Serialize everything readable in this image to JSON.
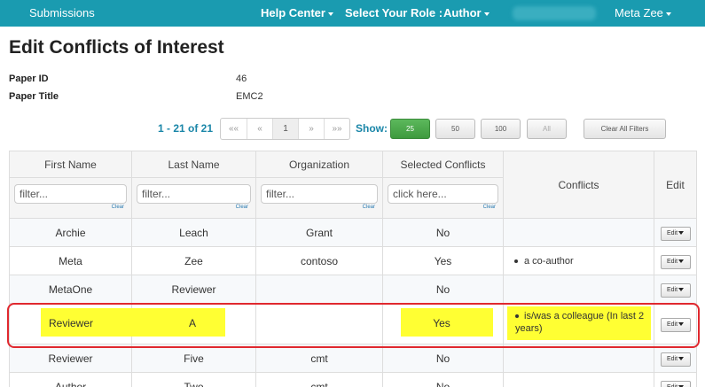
{
  "nav": {
    "submissions": "Submissions",
    "help_center": "Help Center",
    "select_role_label": "Select Your Role :",
    "role": "Author",
    "user": "Meta Zee"
  },
  "page": {
    "title": "Edit Conflicts of Interest",
    "paper_id_label": "Paper ID",
    "paper_id": "46",
    "paper_title_label": "Paper Title",
    "paper_title": "EMC2"
  },
  "pager": {
    "range": "1 - 21 of 21",
    "first": "««",
    "prev": "«",
    "current": "1",
    "next": "»",
    "last": "»»",
    "show_label": "Show:",
    "sizes": [
      "25",
      "50",
      "100",
      "All"
    ],
    "clear_filters": "Clear All Filters"
  },
  "table": {
    "columns": [
      "First Name",
      "Last Name",
      "Organization",
      "Selected Conflicts",
      "Conflicts",
      "Edit"
    ],
    "filter_placeholder": "filter...",
    "selected_placeholder": "click here...",
    "clear_label": "Clear",
    "edit_label": "Edit",
    "rows": [
      {
        "first": "Archie",
        "last": "Leach",
        "org": "Grant",
        "selected": "No",
        "conflicts": ""
      },
      {
        "first": "Meta",
        "last": "Zee",
        "org": "contoso",
        "selected": "Yes",
        "conflicts": "a co-author"
      },
      {
        "first": "MetaOne",
        "last": "Reviewer",
        "org": "",
        "selected": "No",
        "conflicts": ""
      },
      {
        "first": "Reviewer",
        "last": "A",
        "org": "",
        "selected": "Yes",
        "conflicts": "is/was a colleague (In last 2 years)"
      },
      {
        "first": "Reviewer",
        "last": "Five",
        "org": "cmt",
        "selected": "No",
        "conflicts": ""
      },
      {
        "first": "Author",
        "last": "Two",
        "org": "cmt",
        "selected": "No",
        "conflicts": ""
      }
    ]
  },
  "colors": {
    "nav": "#1a9bb0",
    "highlight": "#ffff33",
    "outline": "#e0282e",
    "show_active": "#5cb85c"
  }
}
